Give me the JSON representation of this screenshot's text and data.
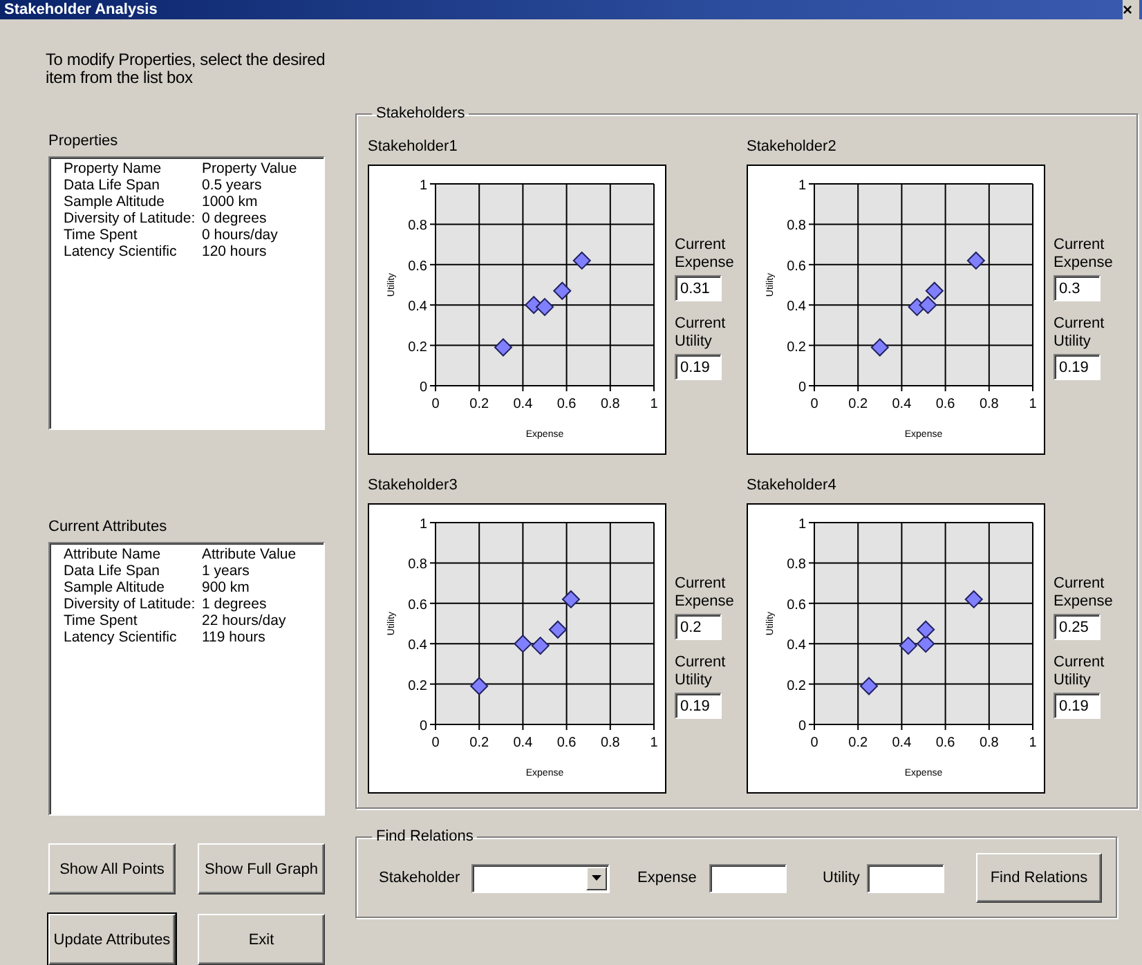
{
  "window": {
    "title": "Stakeholder Analysis",
    "close": "×"
  },
  "instructions": "To modify Properties, select the desired item from the list box",
  "properties": {
    "label": "Properties",
    "columns": [
      "Property Name",
      "Property Value"
    ],
    "rows": [
      {
        "name": "Data Life Span",
        "value": "0.5 years"
      },
      {
        "name": "Sample Altitude",
        "value": "1000 km"
      },
      {
        "name": "Diversity of Latitude:",
        "value": "0 degrees"
      },
      {
        "name": "Time Spent",
        "value": "0 hours/day"
      },
      {
        "name": "Latency Scientific",
        "value": "120 hours"
      }
    ]
  },
  "attributes": {
    "label": "Current Attributes",
    "columns": [
      "Attribute Name",
      "Attribute Value"
    ],
    "rows": [
      {
        "name": "Data Life Span",
        "value": "1 years"
      },
      {
        "name": "Sample Altitude",
        "value": "900 km"
      },
      {
        "name": "Diversity of Latitude:",
        "value": "1 degrees"
      },
      {
        "name": "Time Spent",
        "value": "22 hours/day"
      },
      {
        "name": "Latency Scientific",
        "value": "119 hours"
      }
    ]
  },
  "buttons": [
    "Show All Points",
    "Show Full Graph",
    "Update Attributes",
    "Exit"
  ],
  "stakeholders_group": {
    "title": "Stakeholders",
    "items": [
      {
        "title": "Stakeholder1",
        "expense_label": "Current Expense",
        "expense": "0.31",
        "utility_label": "Current Utility",
        "utility": "0.19",
        "chart_data": {
          "type": "scatter",
          "xlabel": "Expense",
          "ylabel": "Utility",
          "x": [
            0.31,
            0.45,
            0.5,
            0.58,
            0.67
          ],
          "series": [
            {
              "color": "#8080ff",
              "values": [
                0.19,
                0.4,
                0.39,
                0.47,
                0.62
              ]
            }
          ],
          "xlim": [
            0,
            1
          ],
          "ylim": [
            0,
            1
          ],
          "xticks": [
            0,
            0.2,
            0.4,
            0.6,
            0.8,
            1
          ],
          "yticks": [
            0,
            0.2,
            0.4,
            0.6,
            0.8,
            1
          ],
          "grid": true
        }
      },
      {
        "title": "Stakeholder2",
        "expense_label": "Current Expense",
        "expense": "0.3",
        "utility_label": "Current Utility",
        "utility": "0.19",
        "chart_data": {
          "type": "scatter",
          "xlabel": "Expense",
          "ylabel": "Utility",
          "x": [
            0.3,
            0.47,
            0.52,
            0.55,
            0.74
          ],
          "series": [
            {
              "color": "#8080ff",
              "values": [
                0.19,
                0.39,
                0.4,
                0.47,
                0.62
              ]
            }
          ],
          "xlim": [
            0,
            1
          ],
          "ylim": [
            0,
            1
          ],
          "xticks": [
            0,
            0.2,
            0.4,
            0.6,
            0.8,
            1
          ],
          "yticks": [
            0,
            0.2,
            0.4,
            0.6,
            0.8,
            1
          ],
          "grid": true
        }
      },
      {
        "title": "Stakeholder3",
        "expense_label": "Current Expense",
        "expense": "0.2",
        "utility_label": "Current Utility",
        "utility": "0.19",
        "chart_data": {
          "type": "scatter",
          "xlabel": "Expense",
          "ylabel": "Utility",
          "x": [
            0.2,
            0.4,
            0.48,
            0.56,
            0.62
          ],
          "series": [
            {
              "color": "#8080ff",
              "values": [
                0.19,
                0.4,
                0.39,
                0.47,
                0.62
              ]
            }
          ],
          "xlim": [
            0,
            1
          ],
          "ylim": [
            0,
            1
          ],
          "xticks": [
            0,
            0.2,
            0.4,
            0.6,
            0.8,
            1
          ],
          "yticks": [
            0,
            0.2,
            0.4,
            0.6,
            0.8,
            1
          ],
          "grid": true
        }
      },
      {
        "title": "Stakeholder4",
        "expense_label": "Current Expense",
        "expense": "0.25",
        "utility_label": "Current Utility",
        "utility": "0.19",
        "chart_data": {
          "type": "scatter",
          "xlabel": "Expense",
          "ylabel": "Utility",
          "x": [
            0.25,
            0.43,
            0.51,
            0.51,
            0.73
          ],
          "series": [
            {
              "color": "#8080ff",
              "values": [
                0.19,
                0.39,
                0.4,
                0.47,
                0.62
              ]
            }
          ],
          "xlim": [
            0,
            1
          ],
          "ylim": [
            0,
            1
          ],
          "xticks": [
            0,
            0.2,
            0.4,
            0.6,
            0.8,
            1
          ],
          "yticks": [
            0,
            0.2,
            0.4,
            0.6,
            0.8,
            1
          ],
          "grid": true
        }
      }
    ]
  },
  "find_relations": {
    "title": "Find Relations",
    "stakeholder_label": "Stakeholder",
    "expense_label": "Expense",
    "utility_label": "Utility",
    "button": "Find Relations"
  }
}
